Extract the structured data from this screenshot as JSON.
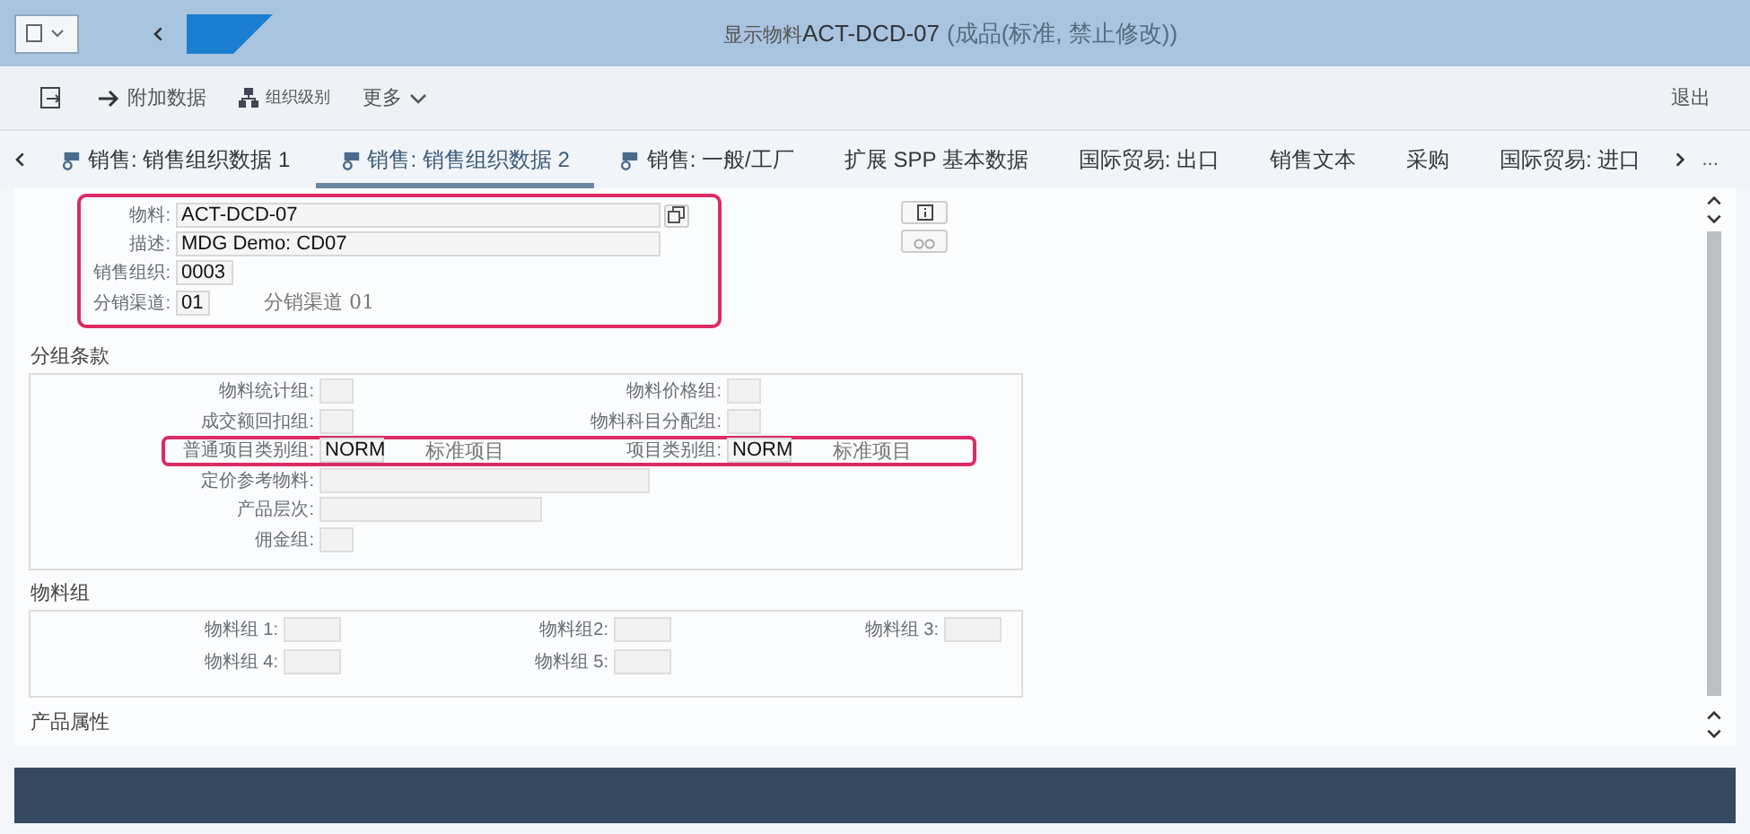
{
  "header": {
    "title_prefix": "显示物料",
    "title_main": "ACT-DCD-07",
    "title_suffix": "(成品(标准, 禁止修改))"
  },
  "toolbar": {
    "buttons": [
      {
        "kind": "icon"
      },
      {
        "kind": "arrow",
        "label": "附加数据"
      },
      {
        "kind": "org",
        "label": "组织级别"
      },
      {
        "kind": "more",
        "label": "更多"
      }
    ],
    "exit": "退出"
  },
  "tabs": [
    {
      "label": "销售: 销售组织数据 1",
      "icon": true,
      "selected": false
    },
    {
      "label": "销售: 销售组织数据 2",
      "icon": true,
      "selected": true
    },
    {
      "label": "销售: 一般/工厂",
      "icon": true,
      "selected": false
    },
    {
      "label": "扩展 SPP 基本数据",
      "icon": false,
      "selected": false
    },
    {
      "label": "国际贸易: 出口",
      "icon": false,
      "selected": false
    },
    {
      "label": "销售文本",
      "icon": false,
      "selected": false
    },
    {
      "label": "采购",
      "icon": false,
      "selected": false
    },
    {
      "label": "国际贸易: 进口",
      "icon": false,
      "selected": false
    }
  ],
  "more_tabs": "...",
  "key_fields": {
    "highlighted": true,
    "rows": [
      {
        "label": "物料:",
        "value": "ACT-DCD-07",
        "copy": true
      },
      {
        "label": "描述:",
        "value": "MDG Demo: CD07"
      },
      {
        "label": "销售组织:",
        "value": "0003"
      },
      {
        "label": "分销渠道:",
        "value": "01",
        "description": "分销渠道  01"
      }
    ]
  },
  "grouping": {
    "title": "分组条款",
    "rows": [
      {
        "highlighted": false,
        "cells": [
          {
            "label": "物料统计组:"
          },
          {
            "label": "物料价格组:"
          }
        ]
      },
      {
        "highlighted": false,
        "cells": [
          {
            "label": "成交额回扣组:"
          },
          {
            "label": "物料科目分配组:"
          }
        ]
      },
      {
        "highlighted": true,
        "cells": [
          {
            "label": "普通项目类别组:",
            "value": "NORM",
            "description": "标准项目"
          },
          {
            "label": "项目类别组:",
            "value": "NORM",
            "description": "标准项目"
          }
        ]
      },
      {
        "highlighted": false,
        "cells": [
          {
            "label": "定价参考物料:"
          }
        ]
      },
      {
        "highlighted": false,
        "cells": [
          {
            "label": "产品层次:"
          }
        ]
      },
      {
        "highlighted": false,
        "cells": [
          {
            "label": "佣金组:"
          }
        ]
      }
    ]
  },
  "material_groups": {
    "title": "物料组",
    "rows": [
      [
        {
          "label": "物料组 1:"
        },
        {
          "label": "物料组2:"
        },
        {
          "label": "物料组 3:"
        }
      ],
      [
        {
          "label": "物料组 4:"
        },
        {
          "label": "物料组 5:"
        }
      ]
    ]
  },
  "next_section": {
    "title": "产品属性"
  }
}
